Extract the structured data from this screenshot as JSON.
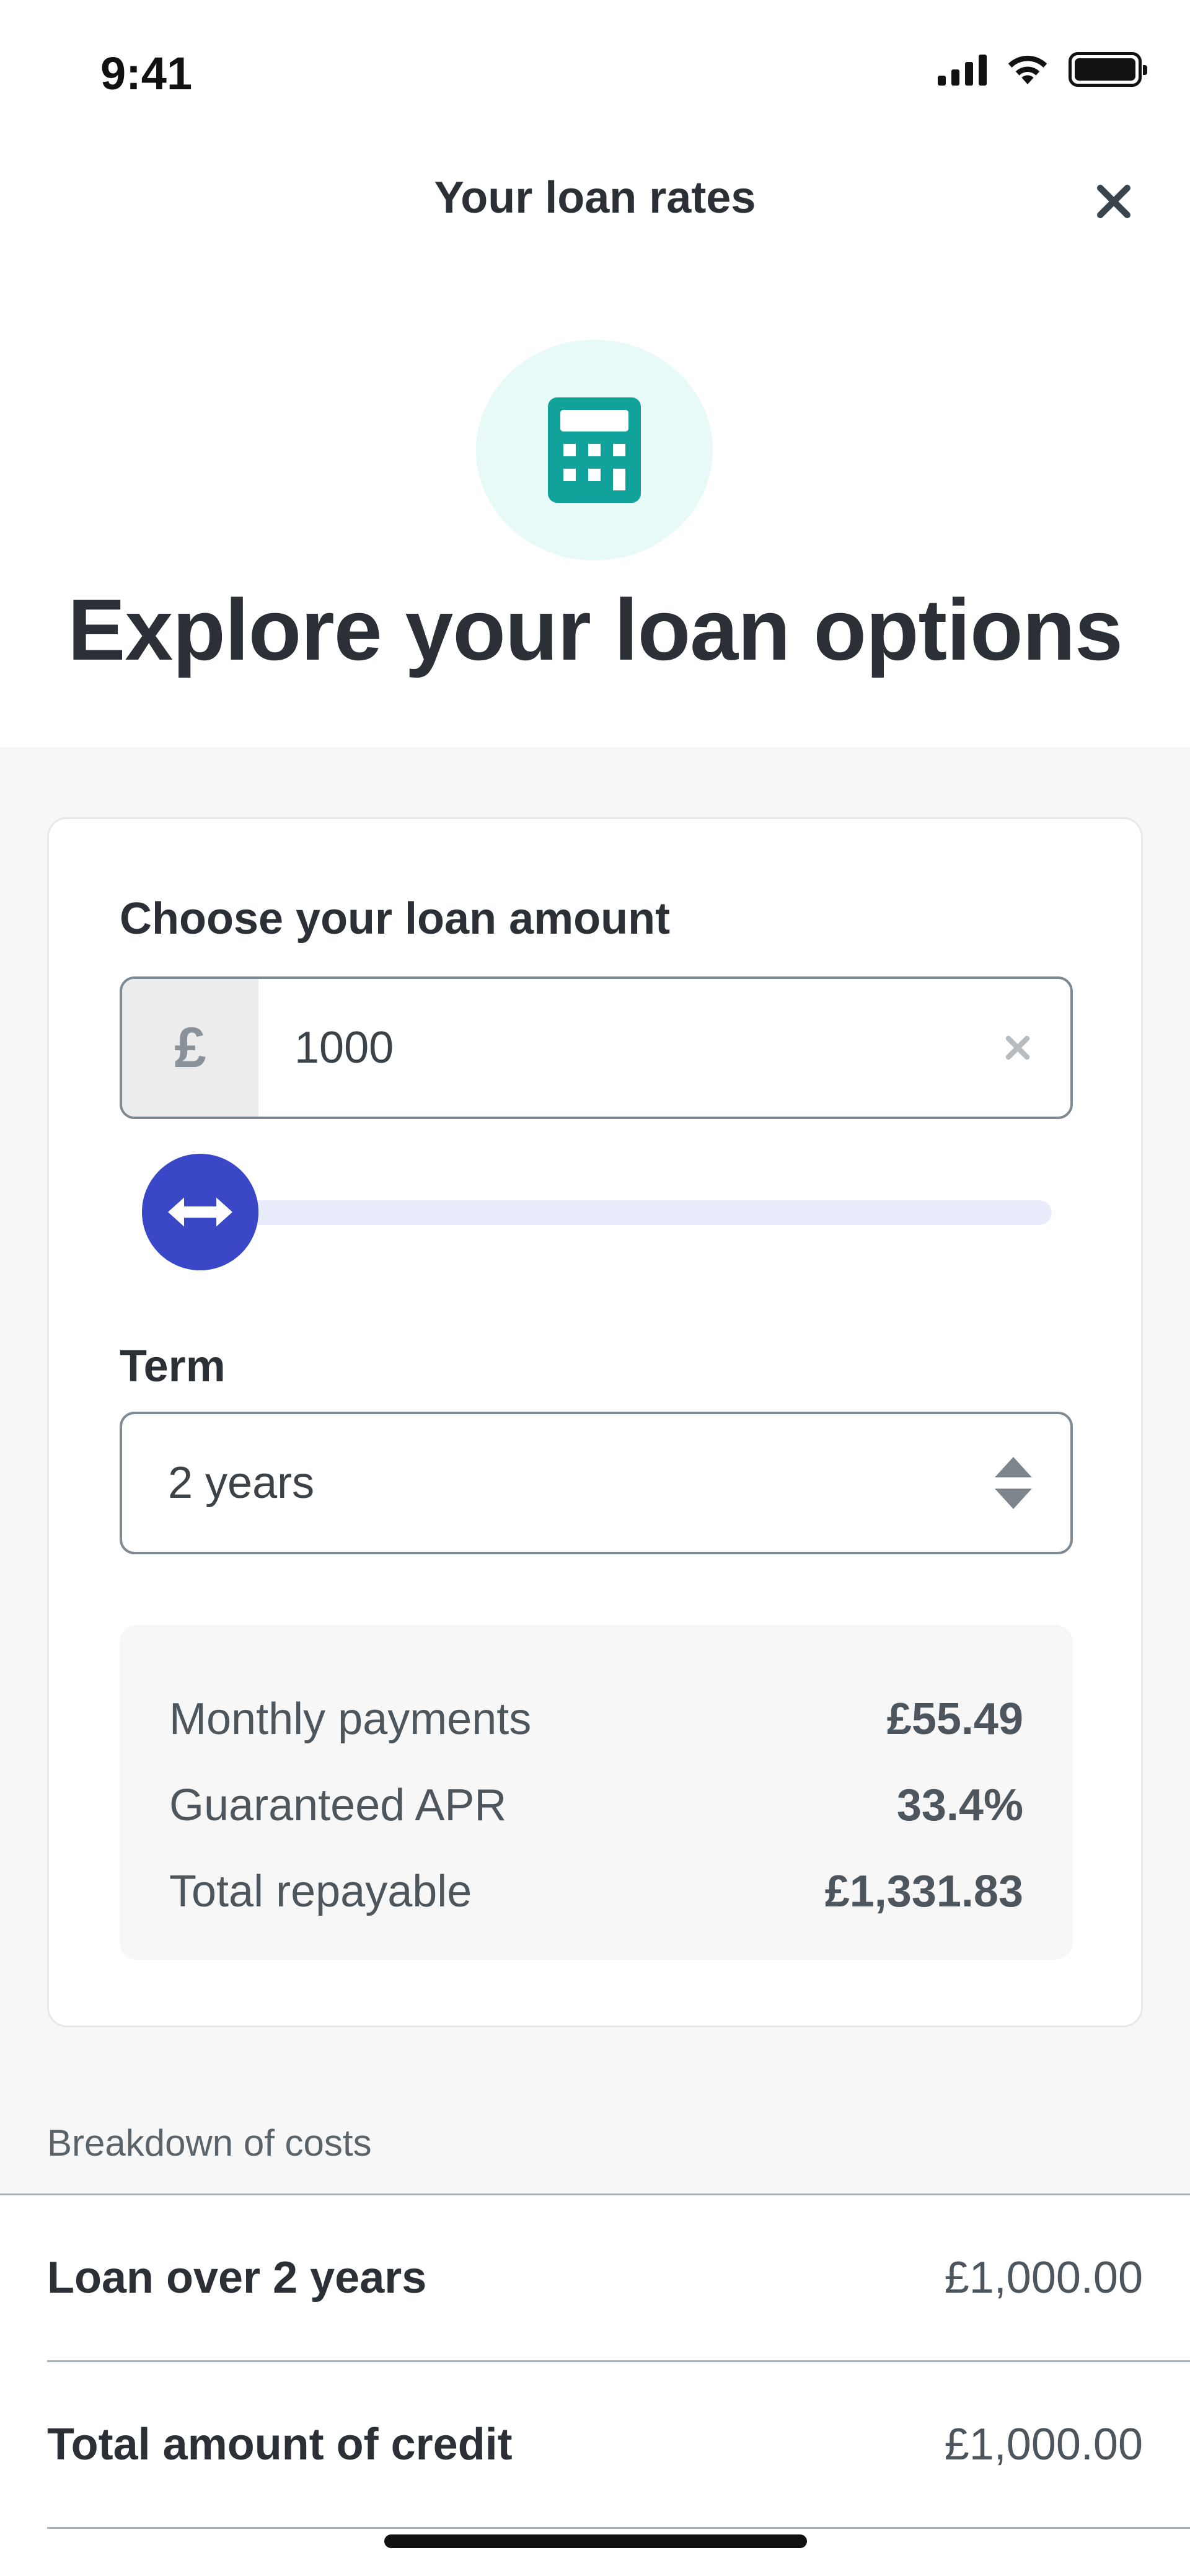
{
  "status_bar": {
    "time": "9:41"
  },
  "nav": {
    "title": "Your loan rates"
  },
  "hero": {
    "icon": "calculator-icon",
    "title": "Explore your loan options"
  },
  "calculator": {
    "amount_label": "Choose your loan amount",
    "currency_symbol": "£",
    "amount_value": "1000",
    "slider_position": 0,
    "term_label": "Term",
    "term_value": "2 years",
    "summary": [
      {
        "label": "Monthly payments",
        "value": "£55.49"
      },
      {
        "label": "Guaranteed APR",
        "value": "33.4%"
      },
      {
        "label": "Total repayable",
        "value": "£1,331.83"
      }
    ]
  },
  "breakdown": {
    "title": "Breakdown of costs",
    "rows": [
      {
        "label": "Loan over 2 years",
        "value": "£1,000.00"
      },
      {
        "label": "Total amount of credit",
        "value": "£1,000.00"
      }
    ]
  },
  "colors": {
    "accent": "#3a47c6",
    "teal_icon": "#11a39b",
    "teal_bg": "#e8faf7",
    "text_dark": "#2b3036"
  }
}
